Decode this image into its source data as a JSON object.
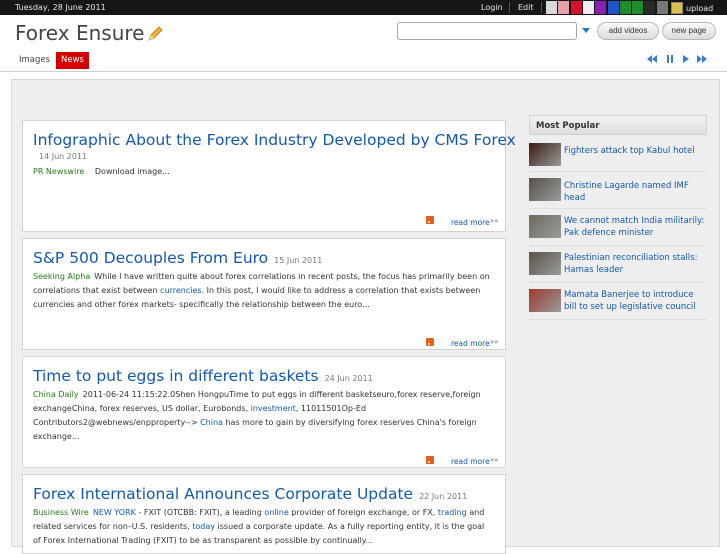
{
  "topbar": {
    "date": "Tuesday, 28 June 2011",
    "login": "Login",
    "edit": "Edit",
    "upload": "upload",
    "swatches": [
      "#d9d9d9",
      "#e6a0a8",
      "#d8102a",
      "#eeeeee",
      "#8a1fb4",
      "#1f55c8",
      "#1e8c2c",
      "#1f8c2c",
      "#2a2a2a",
      "#777777"
    ]
  },
  "header": {
    "logo": "Forex Ensure",
    "search_placeholder": "",
    "add_videos": "add videos",
    "new_page": "new page"
  },
  "nav": {
    "tabs": [
      {
        "label": "Images",
        "active": false
      },
      {
        "label": "News",
        "active": true
      }
    ]
  },
  "articles": [
    {
      "title": "Infographic About the Forex Industry Developed by CMS Forex",
      "date": "14 Jun 2011",
      "source": "PR Newswire",
      "body": "Download image...",
      "readmore": "read more"
    },
    {
      "title": "S&P 500 Decouples From Euro",
      "date": "15 Jun 2011",
      "source": "Seeking Alpha",
      "body_before": "While I have written quite about forex correlations in recent posts, the focus has primarily been on correlations that exist between ",
      "link": "currencies",
      "body_after": ". In this post, I would like to address a correlation that exists between currencies and other forex markets- specifically the relationship between the euro...",
      "readmore": "read more"
    },
    {
      "title": "Time to put eggs in different baskets",
      "date": "24 Jun 2011",
      "source": "China Daily",
      "body_a": "2011-06-24 11:15:22.0Shen HongpuTime to put eggs in different basketseuro,forex reserve,foreign exchangeChina, forex reserves, US dollar, Eurobonds, ",
      "link1": "investment",
      "body_b": ", 11011501Op-Ed Contributors2@webnews/enpproperty--> ",
      "link2": "China",
      "body_c": " has more to gain by diversifying forex reserves China's foreign exchange...",
      "readmore": "read more"
    },
    {
      "title": "Forex International Announces Corporate Update",
      "date": "22 Jun 2011",
      "source": "Business Wire",
      "link1": "NEW YORK",
      "body_a": " - FXIT (OTCBB: FXIT), a leading ",
      "link2": "online",
      "body_b": " provider of foreign exchange, or FX, ",
      "link3": "trading",
      "body_c": " and related services for non–U.S. residents, ",
      "link4": "today",
      "body_d": " issued a corporate update. As a fully reporting entity, it is the goal of Forex International Trading (FXIT) to be as transparent as possible by continually..."
    }
  ],
  "sidebar": {
    "title": "Most Popular",
    "items": [
      {
        "text": "Fighters attack top Kabul hotel",
        "thumb": "#3a1c10"
      },
      {
        "text": "Christine Lagarde named IMF head",
        "thumb": "#56504a"
      },
      {
        "text": "We cannot match India militarily: Pak defence minister",
        "thumb": "#6d6a5e"
      },
      {
        "text": "Palestinian reconciliation stalls: Hamas leader",
        "thumb": "#5b5248"
      },
      {
        "text": "Mamata Banerjee to introduce bill to set up legislative council",
        "thumb": "#9c3a2f"
      }
    ]
  }
}
